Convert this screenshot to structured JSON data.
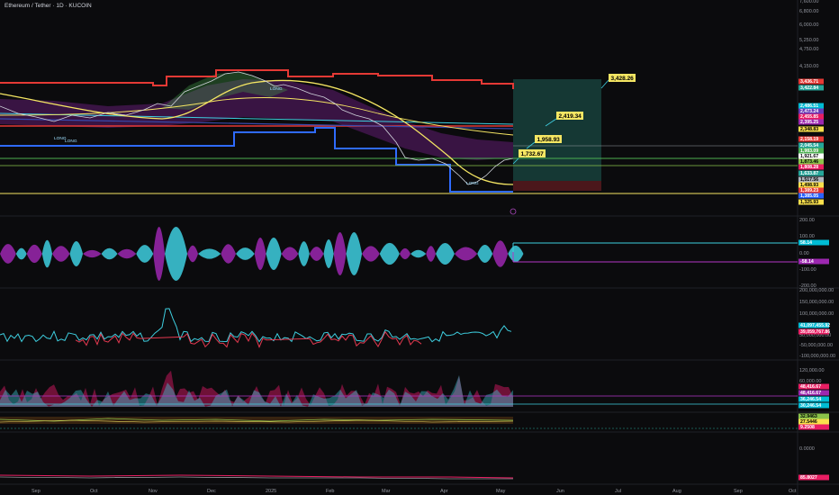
{
  "header": {
    "title": "Ethereum / Tether · 1D · KUCOIN"
  },
  "price_axis": [
    "7,600.00",
    "6,800.00",
    "6,000.00",
    "5,250.00",
    "4,750.00",
    "4,150.00"
  ],
  "price_tags": [
    {
      "text": "3,436.71",
      "color": "#e53935"
    },
    {
      "text": "3,422.84",
      "color": "#26a69a"
    },
    {
      "text": "2,486.51",
      "color": "#00bcd4"
    },
    {
      "text": "2,473.24",
      "color": "#673ab7"
    },
    {
      "text": "2,455.85",
      "color": "#e91e63"
    },
    {
      "text": "2,395.25",
      "color": "#9c27b0"
    },
    {
      "text": "2,348.83",
      "color": "#f9e04c"
    },
    {
      "text": "2,158.19",
      "color": "#e53935"
    },
    {
      "text": "2,045.54",
      "color": "#26a69a"
    },
    {
      "text": "1,983.09",
      "color": "#4caf50"
    },
    {
      "text": "1,921.67",
      "color": "#ffffff"
    },
    {
      "text": "1,873.46",
      "color": "#8bc34a"
    },
    {
      "text": "1,808.28",
      "color": "#e91e63"
    },
    {
      "text": "1,633.87",
      "color": "#26a69a"
    },
    {
      "text": "1,517.56",
      "color": "#b2b5be"
    },
    {
      "text": "1,498.93",
      "color": "#f9e04c"
    },
    {
      "text": "1,389.23",
      "color": "#e53935"
    },
    {
      "text": "1,385.05",
      "color": "#2962ff"
    },
    {
      "text": "1,325.93",
      "color": "#f9e04c"
    }
  ],
  "callouts": [
    {
      "text": "3,428.26"
    },
    {
      "text": "2,419.34"
    },
    {
      "text": "1,958.93"
    },
    {
      "text": "1,732.67"
    }
  ],
  "signal_labels": [
    "LONG",
    "LONG",
    "LONG",
    "LONG"
  ],
  "pane2_axis": [
    "200.00",
    "100.00",
    "0.00",
    "-100.00",
    "-200.00"
  ],
  "pane2_tags": [
    {
      "text": "58.14",
      "color": "#00bcd4"
    },
    {
      "text": "-58.14",
      "color": "#9c27b0"
    }
  ],
  "pane3_axis": [
    "200,000,000.00",
    "150,000,000.00",
    "100,000,000.00",
    "50,000,000.00",
    "-50,000,000.00",
    "-100,000,000.00"
  ],
  "pane3_tags": [
    {
      "text": "41,097,455.92",
      "color": "#00bcd4"
    },
    {
      "text": "39,059,767.86",
      "color": "#e91e63"
    }
  ],
  "pane4_axis": [
    "120,000.00",
    "60,000.00"
  ],
  "pane4_tags": [
    {
      "text": "48,416.67",
      "color": "#e91e63"
    },
    {
      "text": "48,416.67",
      "color": "#9c27b0"
    },
    {
      "text": "36,246.54",
      "color": "#00bcd4"
    },
    {
      "text": "30,246.54",
      "color": "#00bcd4"
    }
  ],
  "pane5_tags": [
    {
      "text": "32.9463",
      "color": "#8bc34a"
    },
    {
      "text": "27.5446",
      "color": "#f9e04c"
    },
    {
      "text": "9.2508",
      "color": "#e91e63"
    }
  ],
  "pane6_axis": [
    "0.0000"
  ],
  "pane6_tags": [
    {
      "text": "85.8027",
      "color": "#e91e63"
    }
  ],
  "time_axis": [
    "Sep",
    "Oct",
    "Nov",
    "Dec",
    "2025",
    "Feb",
    "Mar",
    "Apr",
    "May",
    "Jun",
    "Jul",
    "Aug",
    "Sep",
    "Oct"
  ],
  "colors": {
    "background": "#0b0b0d",
    "upper_band": "#e53935",
    "lower_band": "#2f6bff",
    "ma_yellow": "#f5e663",
    "cyan": "#3ecfe0",
    "magenta": "#b437c8",
    "crimson": "#c2185b",
    "target_zone": "#1f5f55",
    "stop_zone": "#5b1a1f"
  }
}
